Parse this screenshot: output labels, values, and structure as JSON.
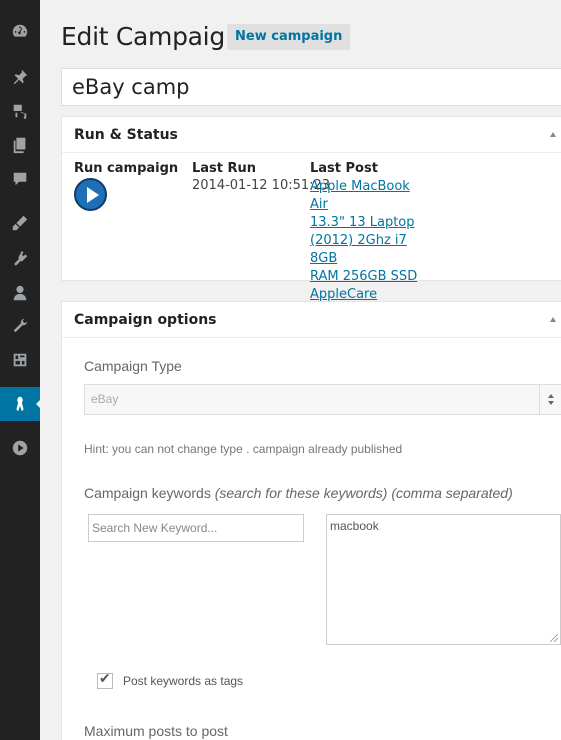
{
  "page": {
    "title": "Edit Campaign",
    "add_new_label": "New campaign",
    "campaign_title": "eBay camp"
  },
  "admin_menu": {
    "items": [
      {
        "icon": "dashboard-icon"
      },
      {
        "icon": "pin-icon"
      },
      {
        "icon": "media-icon"
      },
      {
        "icon": "pages-icon"
      },
      {
        "icon": "comments-icon"
      },
      {
        "icon": "appearance-icon"
      },
      {
        "icon": "plugins-icon"
      },
      {
        "icon": "users-icon"
      },
      {
        "icon": "tools-icon"
      },
      {
        "icon": "settings-icon"
      },
      {
        "icon": "wp-automatic-icon",
        "active": true
      },
      {
        "icon": "play-icon"
      }
    ],
    "active_color": "#0074a2"
  },
  "run_status": {
    "title": "Run & Status",
    "run_campaign_label": "Run campaign",
    "last_run_label": "Last Run",
    "last_run_value": "2014-01-12 10:51:23",
    "last_post_label": "Last Post",
    "last_post_lines": [
      "Apple MacBook Air",
      "13.3\" 13 Laptop",
      "(2012) 2Ghz i7 8GB",
      "RAM 256GB SSD",
      "AppleCare"
    ]
  },
  "campaign_options": {
    "title": "Campaign options",
    "type_label": "Campaign Type",
    "type_value": "eBay",
    "hint": "Hint: you can not change type . campaign already published",
    "keywords_label": "Campaign keywords",
    "keywords_hint": "(search for these keywords) (comma separated)",
    "keyword_placeholder": "Search New Keyword...",
    "keywords_value": "macbook",
    "post_keywords_tags_label": "Post keywords as tags",
    "post_keywords_tags_checked": true,
    "max_posts_label": "Maximum posts to post"
  },
  "colors": {
    "link": "#0074a2",
    "menu_bg": "#222222",
    "play_button": "#1e6fb6"
  }
}
